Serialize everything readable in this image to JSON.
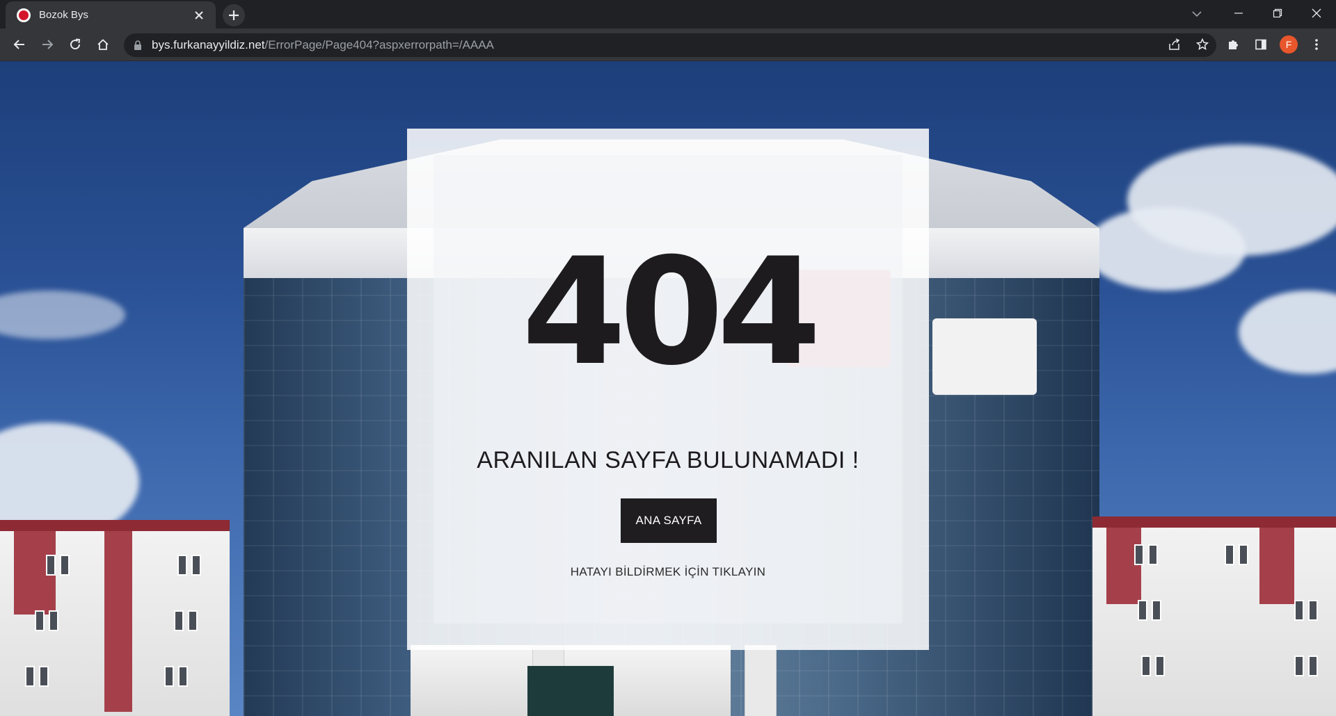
{
  "browser": {
    "tab": {
      "title": "Bozok Bys"
    },
    "url": {
      "host": "bys.furkanayyildiz.net",
      "path": "/ErrorPage/Page404?aspxerrorpath=/AAAA"
    },
    "profile_initial": "F"
  },
  "icons": {
    "favicon": "opera-favicon-icon",
    "tab_close": "close-icon",
    "new_tab": "plus-icon",
    "tab_search": "chevron-down-icon",
    "minimize": "minimize-icon",
    "restore": "restore-icon",
    "close_window": "close-icon",
    "back": "arrow-left-icon",
    "forward": "arrow-right-icon",
    "reload": "reload-icon",
    "home": "home-icon",
    "lock": "lock-icon",
    "share": "share-icon",
    "bookmark": "star-icon",
    "extensions": "puzzle-icon",
    "side_panel": "side-panel-icon",
    "menu": "kebab-menu-icon"
  },
  "colors": {
    "chrome_dark": "#202124",
    "chrome_toolbar": "#35363a",
    "error_text": "#1d1b1e",
    "button_bg": "#1f1d1f",
    "profile_avatar": "#e8562b",
    "favicon_red": "#d3162b"
  },
  "page": {
    "error_code": "404",
    "message": "ARANILAN SAYFA BULUNAMADI !",
    "home_button": "ANA SAYFA",
    "report_link": "HATAYI BİLDİRMEK İÇİN TIKLAYIN"
  }
}
